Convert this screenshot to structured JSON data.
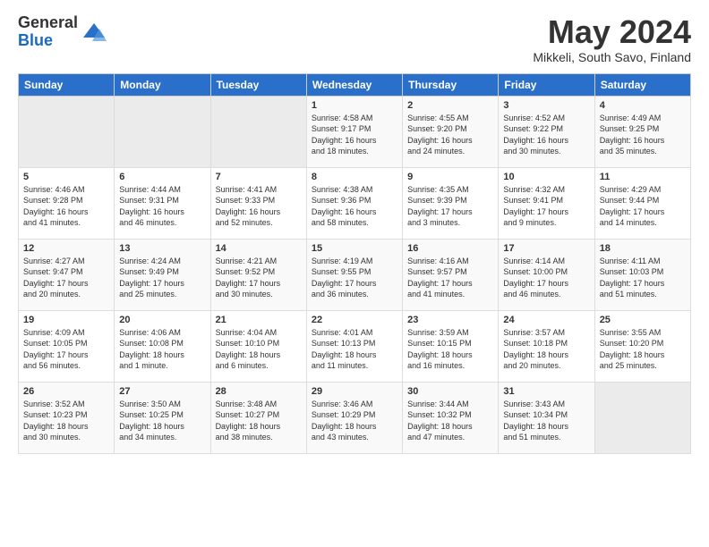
{
  "logo": {
    "general": "General",
    "blue": "Blue"
  },
  "title": {
    "month_year": "May 2024",
    "location": "Mikkeli, South Savo, Finland"
  },
  "days_of_week": [
    "Sunday",
    "Monday",
    "Tuesday",
    "Wednesday",
    "Thursday",
    "Friday",
    "Saturday"
  ],
  "weeks": [
    [
      {
        "day": "",
        "info": ""
      },
      {
        "day": "",
        "info": ""
      },
      {
        "day": "",
        "info": ""
      },
      {
        "day": "1",
        "info": "Sunrise: 4:58 AM\nSunset: 9:17 PM\nDaylight: 16 hours\nand 18 minutes."
      },
      {
        "day": "2",
        "info": "Sunrise: 4:55 AM\nSunset: 9:20 PM\nDaylight: 16 hours\nand 24 minutes."
      },
      {
        "day": "3",
        "info": "Sunrise: 4:52 AM\nSunset: 9:22 PM\nDaylight: 16 hours\nand 30 minutes."
      },
      {
        "day": "4",
        "info": "Sunrise: 4:49 AM\nSunset: 9:25 PM\nDaylight: 16 hours\nand 35 minutes."
      }
    ],
    [
      {
        "day": "5",
        "info": "Sunrise: 4:46 AM\nSunset: 9:28 PM\nDaylight: 16 hours\nand 41 minutes."
      },
      {
        "day": "6",
        "info": "Sunrise: 4:44 AM\nSunset: 9:31 PM\nDaylight: 16 hours\nand 46 minutes."
      },
      {
        "day": "7",
        "info": "Sunrise: 4:41 AM\nSunset: 9:33 PM\nDaylight: 16 hours\nand 52 minutes."
      },
      {
        "day": "8",
        "info": "Sunrise: 4:38 AM\nSunset: 9:36 PM\nDaylight: 16 hours\nand 58 minutes."
      },
      {
        "day": "9",
        "info": "Sunrise: 4:35 AM\nSunset: 9:39 PM\nDaylight: 17 hours\nand 3 minutes."
      },
      {
        "day": "10",
        "info": "Sunrise: 4:32 AM\nSunset: 9:41 PM\nDaylight: 17 hours\nand 9 minutes."
      },
      {
        "day": "11",
        "info": "Sunrise: 4:29 AM\nSunset: 9:44 PM\nDaylight: 17 hours\nand 14 minutes."
      }
    ],
    [
      {
        "day": "12",
        "info": "Sunrise: 4:27 AM\nSunset: 9:47 PM\nDaylight: 17 hours\nand 20 minutes."
      },
      {
        "day": "13",
        "info": "Sunrise: 4:24 AM\nSunset: 9:49 PM\nDaylight: 17 hours\nand 25 minutes."
      },
      {
        "day": "14",
        "info": "Sunrise: 4:21 AM\nSunset: 9:52 PM\nDaylight: 17 hours\nand 30 minutes."
      },
      {
        "day": "15",
        "info": "Sunrise: 4:19 AM\nSunset: 9:55 PM\nDaylight: 17 hours\nand 36 minutes."
      },
      {
        "day": "16",
        "info": "Sunrise: 4:16 AM\nSunset: 9:57 PM\nDaylight: 17 hours\nand 41 minutes."
      },
      {
        "day": "17",
        "info": "Sunrise: 4:14 AM\nSunset: 10:00 PM\nDaylight: 17 hours\nand 46 minutes."
      },
      {
        "day": "18",
        "info": "Sunrise: 4:11 AM\nSunset: 10:03 PM\nDaylight: 17 hours\nand 51 minutes."
      }
    ],
    [
      {
        "day": "19",
        "info": "Sunrise: 4:09 AM\nSunset: 10:05 PM\nDaylight: 17 hours\nand 56 minutes."
      },
      {
        "day": "20",
        "info": "Sunrise: 4:06 AM\nSunset: 10:08 PM\nDaylight: 18 hours\nand 1 minute."
      },
      {
        "day": "21",
        "info": "Sunrise: 4:04 AM\nSunset: 10:10 PM\nDaylight: 18 hours\nand 6 minutes."
      },
      {
        "day": "22",
        "info": "Sunrise: 4:01 AM\nSunset: 10:13 PM\nDaylight: 18 hours\nand 11 minutes."
      },
      {
        "day": "23",
        "info": "Sunrise: 3:59 AM\nSunset: 10:15 PM\nDaylight: 18 hours\nand 16 minutes."
      },
      {
        "day": "24",
        "info": "Sunrise: 3:57 AM\nSunset: 10:18 PM\nDaylight: 18 hours\nand 20 minutes."
      },
      {
        "day": "25",
        "info": "Sunrise: 3:55 AM\nSunset: 10:20 PM\nDaylight: 18 hours\nand 25 minutes."
      }
    ],
    [
      {
        "day": "26",
        "info": "Sunrise: 3:52 AM\nSunset: 10:23 PM\nDaylight: 18 hours\nand 30 minutes."
      },
      {
        "day": "27",
        "info": "Sunrise: 3:50 AM\nSunset: 10:25 PM\nDaylight: 18 hours\nand 34 minutes."
      },
      {
        "day": "28",
        "info": "Sunrise: 3:48 AM\nSunset: 10:27 PM\nDaylight: 18 hours\nand 38 minutes."
      },
      {
        "day": "29",
        "info": "Sunrise: 3:46 AM\nSunset: 10:29 PM\nDaylight: 18 hours\nand 43 minutes."
      },
      {
        "day": "30",
        "info": "Sunrise: 3:44 AM\nSunset: 10:32 PM\nDaylight: 18 hours\nand 47 minutes."
      },
      {
        "day": "31",
        "info": "Sunrise: 3:43 AM\nSunset: 10:34 PM\nDaylight: 18 hours\nand 51 minutes."
      },
      {
        "day": "",
        "info": ""
      }
    ]
  ]
}
